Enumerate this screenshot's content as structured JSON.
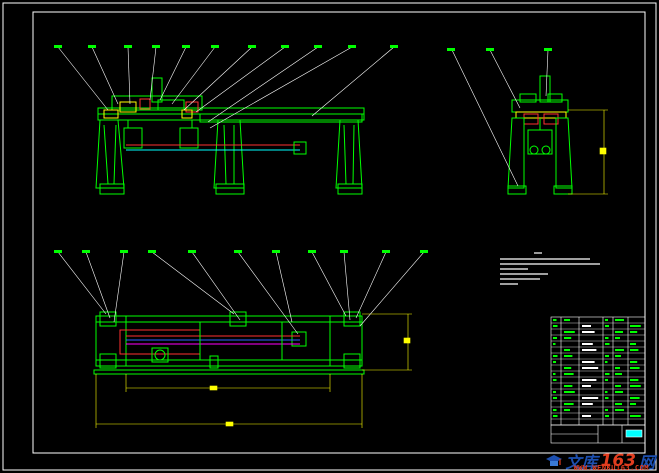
{
  "drawing": {
    "background": "#000000",
    "colors": {
      "frame": "#ffffff",
      "structure": "#00ff00",
      "leader": "#ffffff",
      "dimension": "#ffff00",
      "highlight": "#ff3030",
      "accent_blue": "#3060ff",
      "cyan": "#00ffff",
      "magenta": "#ff00ff"
    }
  },
  "watermark": {
    "text_cn": "文库",
    "text_num": "163",
    "text_wang": "网",
    "url": "WWW.WENKU163.COM",
    "logo_icon": "graduation-cap-icon"
  }
}
